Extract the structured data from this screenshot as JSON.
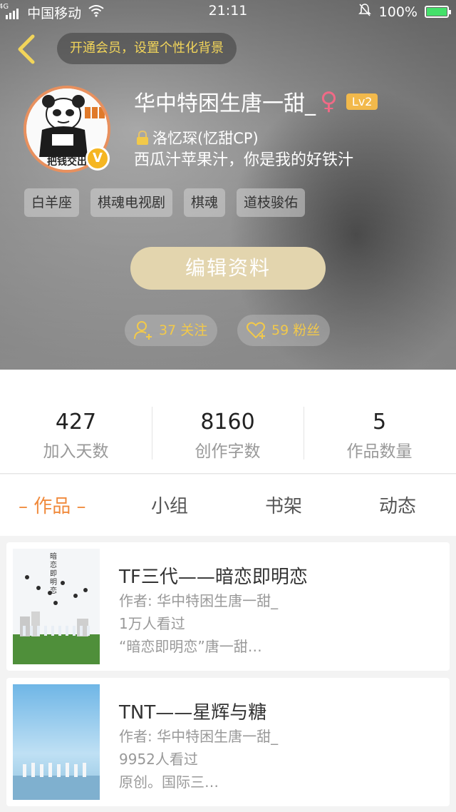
{
  "status_bar": {
    "network_label": "4G",
    "carrier": "中国移动",
    "time": "21:11",
    "battery_percent": "100%"
  },
  "header": {
    "vip_banner": "开通会员，设置个性化背景"
  },
  "profile": {
    "username": "华中特困生唐一甜_",
    "gender_symbol": "♀",
    "level": "Lv2",
    "cp_text": "洛忆琛(忆甜CP)",
    "signature": "西瓜汁苹果汁，你是我的好铁汁",
    "avatar_text": "把钱交出",
    "verified_badge": "V",
    "tags": [
      "白羊座",
      "棋魂电视剧",
      "棋魂",
      "道枝骏佑"
    ],
    "edit_button": "编辑资料",
    "following": "37 关注",
    "followers": "59 粉丝"
  },
  "stats": [
    {
      "value": "427",
      "label": "加入天数"
    },
    {
      "value": "8160",
      "label": "创作字数"
    },
    {
      "value": "5",
      "label": "作品数量"
    }
  ],
  "tabs": [
    {
      "label": "– 作品 –",
      "active": true
    },
    {
      "label": "小组",
      "active": false
    },
    {
      "label": "书架",
      "active": false
    },
    {
      "label": "动态",
      "active": false
    }
  ],
  "works": [
    {
      "title": "TF三代——暗恋即明恋",
      "author": "作者: 华中特困生唐一甜_",
      "views": "1万人看过",
      "snippet": "“暗恋即明恋”唐一甜…",
      "cover_text": "暗恋即明恋"
    },
    {
      "title": "TNT——星辉与糖",
      "author": "作者: 华中特困生唐一甜_",
      "views": "9952人看过",
      "snippet": "原创。国际三…"
    }
  ],
  "colors": {
    "accent_orange": "#f08a3c",
    "gold_text": "#f2c94a",
    "level_badge": "#f2b94b",
    "edit_button": "#e3d5ae"
  }
}
